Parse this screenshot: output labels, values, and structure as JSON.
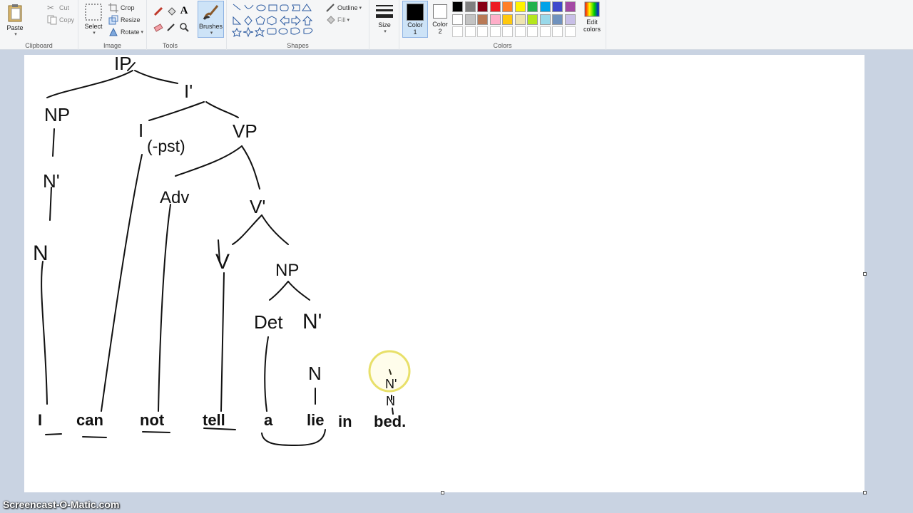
{
  "ribbon": {
    "clipboard": {
      "label": "Clipboard",
      "paste": "Paste",
      "cut": "Cut",
      "copy": "Copy"
    },
    "image": {
      "label": "Image",
      "select": "Select",
      "crop": "Crop",
      "resize": "Resize",
      "rotate": "Rotate"
    },
    "tools": {
      "label": "Tools",
      "brushes": "Brushes"
    },
    "shapes": {
      "label": "Shapes",
      "outline": "Outline",
      "fill": "Fill"
    },
    "size": {
      "label": "Size"
    },
    "colors": {
      "label": "Colors",
      "color1_line1": "Color",
      "color1_line2": "1",
      "color2_line1": "Color",
      "color2_line2": "2",
      "edit_line1": "Edit",
      "edit_line2": "colors",
      "color1": "#000000",
      "color2": "#ffffff",
      "palette_row1": [
        "#000000",
        "#7f7f7f",
        "#880015",
        "#ed1c24",
        "#ff7f27",
        "#fff200",
        "#22b14c",
        "#00a2e8",
        "#3f48cc",
        "#a349a4"
      ],
      "palette_row2": [
        "#ffffff",
        "#c3c3c3",
        "#b97a57",
        "#ffaec9",
        "#ffc90e",
        "#efe4b0",
        "#b5e61d",
        "#99d9ea",
        "#7092be",
        "#c8bfe7"
      ],
      "palette_row3": [
        "#ffffff",
        "#ffffff",
        "#ffffff",
        "#ffffff",
        "#ffffff",
        "#ffffff",
        "#ffffff",
        "#ffffff",
        "#ffffff",
        "#ffffff"
      ]
    }
  },
  "drawing": {
    "words": [
      "I",
      "can",
      "not",
      "tell",
      "a",
      "lie",
      "in",
      "bed."
    ],
    "nodes": [
      "IP",
      "I'",
      "NP",
      "I",
      "(-pst)",
      "VP",
      "N'",
      "Adv",
      "V'",
      "N",
      "V",
      "NP",
      "Det",
      "N'",
      "N",
      "N'",
      "N"
    ]
  },
  "watermark": "Screencast-O-Matic.com"
}
